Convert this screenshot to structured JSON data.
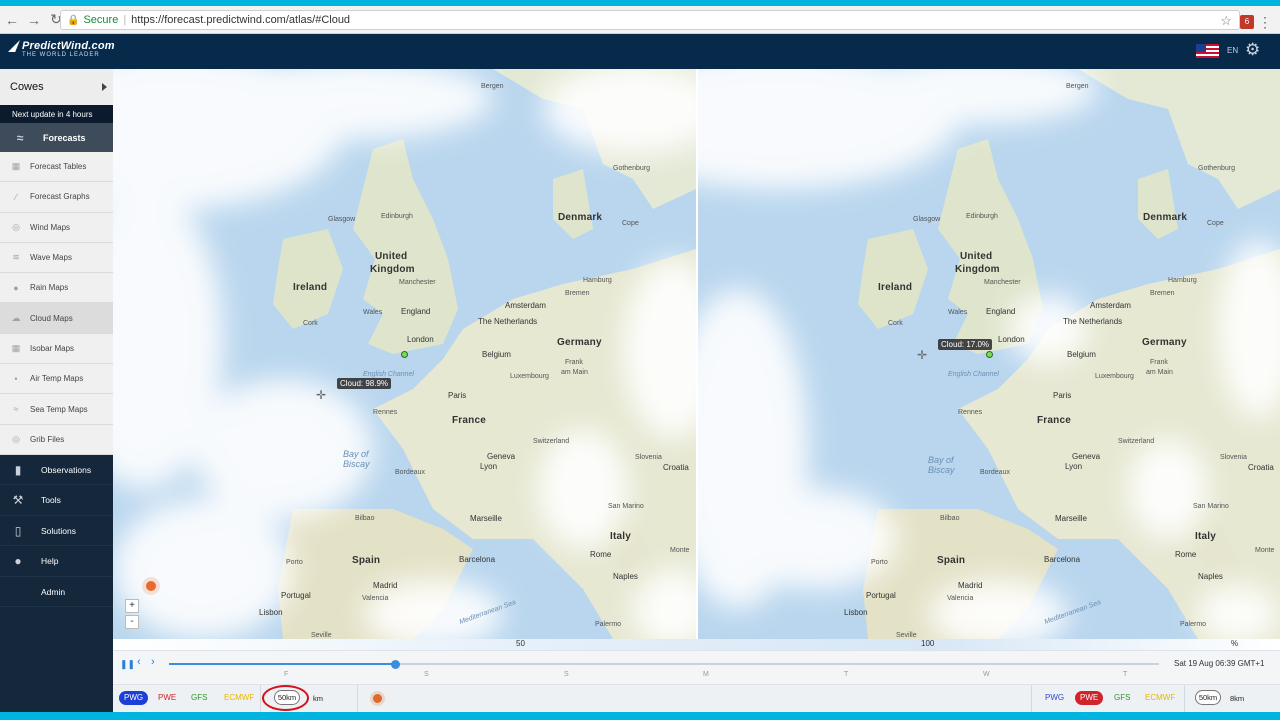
{
  "browser": {
    "secure_label": "Secure",
    "url": "https://forecast.predictwind.com/atlas/#Cloud",
    "extension_badge": "6"
  },
  "header": {
    "logo_text": "PredictWind.com",
    "logo_tagline": "THE WORLD LEADER",
    "language": "EN"
  },
  "sidebar": {
    "location": "Cowes",
    "next_update": "Next update in 4 hours",
    "forecasts_label": "Forecasts",
    "sub_items": [
      {
        "label": "Forecast Tables",
        "icon": "table-icon"
      },
      {
        "label": "Forecast Graphs",
        "icon": "graph-icon"
      },
      {
        "label": "Wind Maps",
        "icon": "wind-icon"
      },
      {
        "label": "Wave Maps",
        "icon": "wave-icon"
      },
      {
        "label": "Rain Maps",
        "icon": "rain-icon"
      },
      {
        "label": "Cloud Maps",
        "icon": "cloud-icon"
      },
      {
        "label": "Isobar Maps",
        "icon": "isobar-icon"
      },
      {
        "label": "Air Temp Maps",
        "icon": "thermometer-icon"
      },
      {
        "label": "Sea Temp Maps",
        "icon": "sea-temp-icon"
      },
      {
        "label": "Grib Files",
        "icon": "globe-icon"
      }
    ],
    "main_items": [
      {
        "label": "Observations",
        "icon": "observations-icon"
      },
      {
        "label": "Tools",
        "icon": "tools-icon"
      },
      {
        "label": "Solutions",
        "icon": "phone-icon"
      },
      {
        "label": "Help",
        "icon": "help-icon"
      },
      {
        "label": "Admin",
        "icon": ""
      }
    ]
  },
  "maps": {
    "left": {
      "tooltip": "Cloud: 98.9%"
    },
    "right": {
      "tooltip": "Cloud: 17.0%"
    },
    "labels": {
      "bergen": "Bergen",
      "gothenburg": "Gothenburg",
      "glasgow": "Glasgow",
      "edinburgh": "Edinburgh",
      "denmark": "Denmark",
      "cope": "Cope",
      "united_kingdom_1": "United",
      "united_kingdom_2": "Kingdom",
      "ireland": "Ireland",
      "manchester": "Manchester",
      "hamburg": "Hamburg",
      "bremen": "Bremen",
      "amsterdam": "Amsterdam",
      "wales": "Wales",
      "england": "England",
      "the_netherlands": "The Netherlands",
      "cork": "Cork",
      "london": "London",
      "germany": "Germany",
      "belgium": "Belgium",
      "frank": "Frank",
      "main": "am Main",
      "luxembourg": "Luxembourg",
      "english_channel": "English Channel",
      "paris": "Paris",
      "rennes": "Rennes",
      "france": "France",
      "switzerland": "Switzerland",
      "lyon": "Lyon",
      "geneva": "Geneva",
      "slovenia": "Slovenia",
      "croatia": "Croatia",
      "bay_of_biscay": "Bay of Biscay",
      "bilbao": "Bilbao",
      "marseille": "Marseille",
      "san_marino": "San Marino",
      "italy": "Italy",
      "porto": "Porto",
      "barcelona": "Barcelona",
      "rome": "Rome",
      "monte": "Monte",
      "spain": "Spain",
      "naples": "Naples",
      "madrid": "Madrid",
      "portugal": "Portugal",
      "valencia": "Valencia",
      "lisbon": "Lisbon",
      "seville": "Seville",
      "palermo": "Palermo",
      "mediterranean_sea": "Mediterranean Sea",
      "bordeaux": "Bordeaux"
    }
  },
  "legend": {
    "mid": "50",
    "high": "100",
    "unit": "%"
  },
  "timeline": {
    "days": [
      "F",
      "S",
      "S",
      "M",
      "T",
      "W",
      "T"
    ],
    "date": "Sat 19 Aug 06:39 GMT+1",
    "progress": 0.228
  },
  "modelbar": {
    "left": {
      "pwg": "PWG",
      "pwe": "PWE",
      "gfs": "GFS",
      "ecmwf": "ECMWF",
      "res": "50km",
      "res_unit": "km"
    },
    "right": {
      "pwg": "PWG",
      "pwe": "PWE",
      "gfs": "GFS",
      "ecmwf": "ECMWF",
      "res": "50km",
      "res_unit": "8km"
    }
  },
  "colors": {
    "header_bg": "#072a4b",
    "sidebar_bg": "#15273b",
    "accent": "#3a8ee0",
    "pwe_red": "#d0242c",
    "pwg_blue": "#1c3fd8"
  }
}
